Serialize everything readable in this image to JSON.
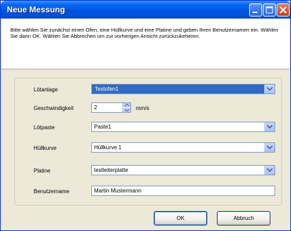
{
  "window": {
    "title": "Neue Messung"
  },
  "instructions": "Bitte wählen Sie zunächst einen Ofen, eine Hüllkurve und eine Platine und geben Ihren Benutzernamen ein. Wählen Sie dann OK. Wählen Sie Abbrechen um zur vorherigen Ansicht zurückzukeheren.",
  "form": {
    "loetanlage": {
      "label": "Lötanlage",
      "value": "Testofen1"
    },
    "geschwindigkeit": {
      "label": "Geschwindigkeit",
      "value": "2",
      "unit": "mm/s"
    },
    "loetpaste": {
      "label": "Lötpaste",
      "value": "Paste1"
    },
    "huellkurve": {
      "label": "Hüllkurve",
      "value": "Hüllkurve 1"
    },
    "platine": {
      "label": "Platine",
      "value": "testleiterplatte"
    },
    "benutzername": {
      "label": "Benutzername",
      "value": "Martin Mustermann"
    }
  },
  "buttons": {
    "ok": "OK",
    "cancel": "Abbruch"
  },
  "icons": {
    "minimize": "minimize-icon",
    "maximize": "maximize-icon",
    "close": "close-icon",
    "dropdown": "chevron-down-icon",
    "spin": "spinner-arrows-icon"
  }
}
